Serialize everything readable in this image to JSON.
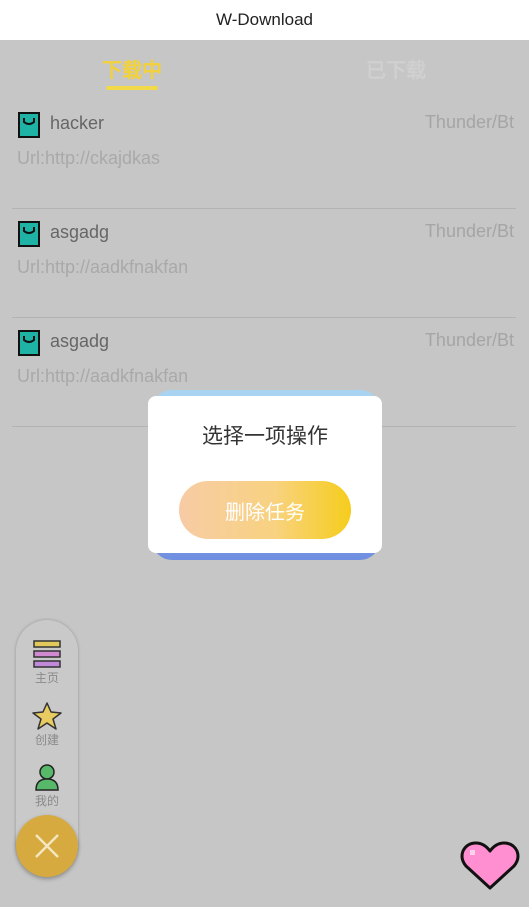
{
  "app": {
    "title": "W-Download"
  },
  "tabs": [
    {
      "label": "下载中",
      "active": true
    },
    {
      "label": "已下载",
      "active": false
    }
  ],
  "tasks": [
    {
      "name": "hacker",
      "type": "Thunder/Bt",
      "url": "Url:http://ckajdkas"
    },
    {
      "name": "asgadg",
      "type": "Thunder/Bt",
      "url": "Url:http://aadkfnakfan"
    },
    {
      "name": "asgadg",
      "type": "Thunder/Bt",
      "url": "Url:http://aadkfnakfan"
    }
  ],
  "dialog": {
    "title": "选择一项操作",
    "action_label": "删除任务"
  },
  "sidenav": {
    "items": [
      {
        "label": "主页",
        "icon": "menu-icon"
      },
      {
        "label": "创建",
        "icon": "star-icon"
      },
      {
        "label": "我的",
        "icon": "user-icon"
      }
    ],
    "fab_icon": "close-icon"
  },
  "decor": {
    "heart_icon": "heart-icon"
  },
  "colors": {
    "accent": "#f3d13a",
    "overlay": "#c6c6c6",
    "fab": "#d6aa3e",
    "file_icon": "#1fb3a5",
    "heart": "#ff8fd0"
  }
}
